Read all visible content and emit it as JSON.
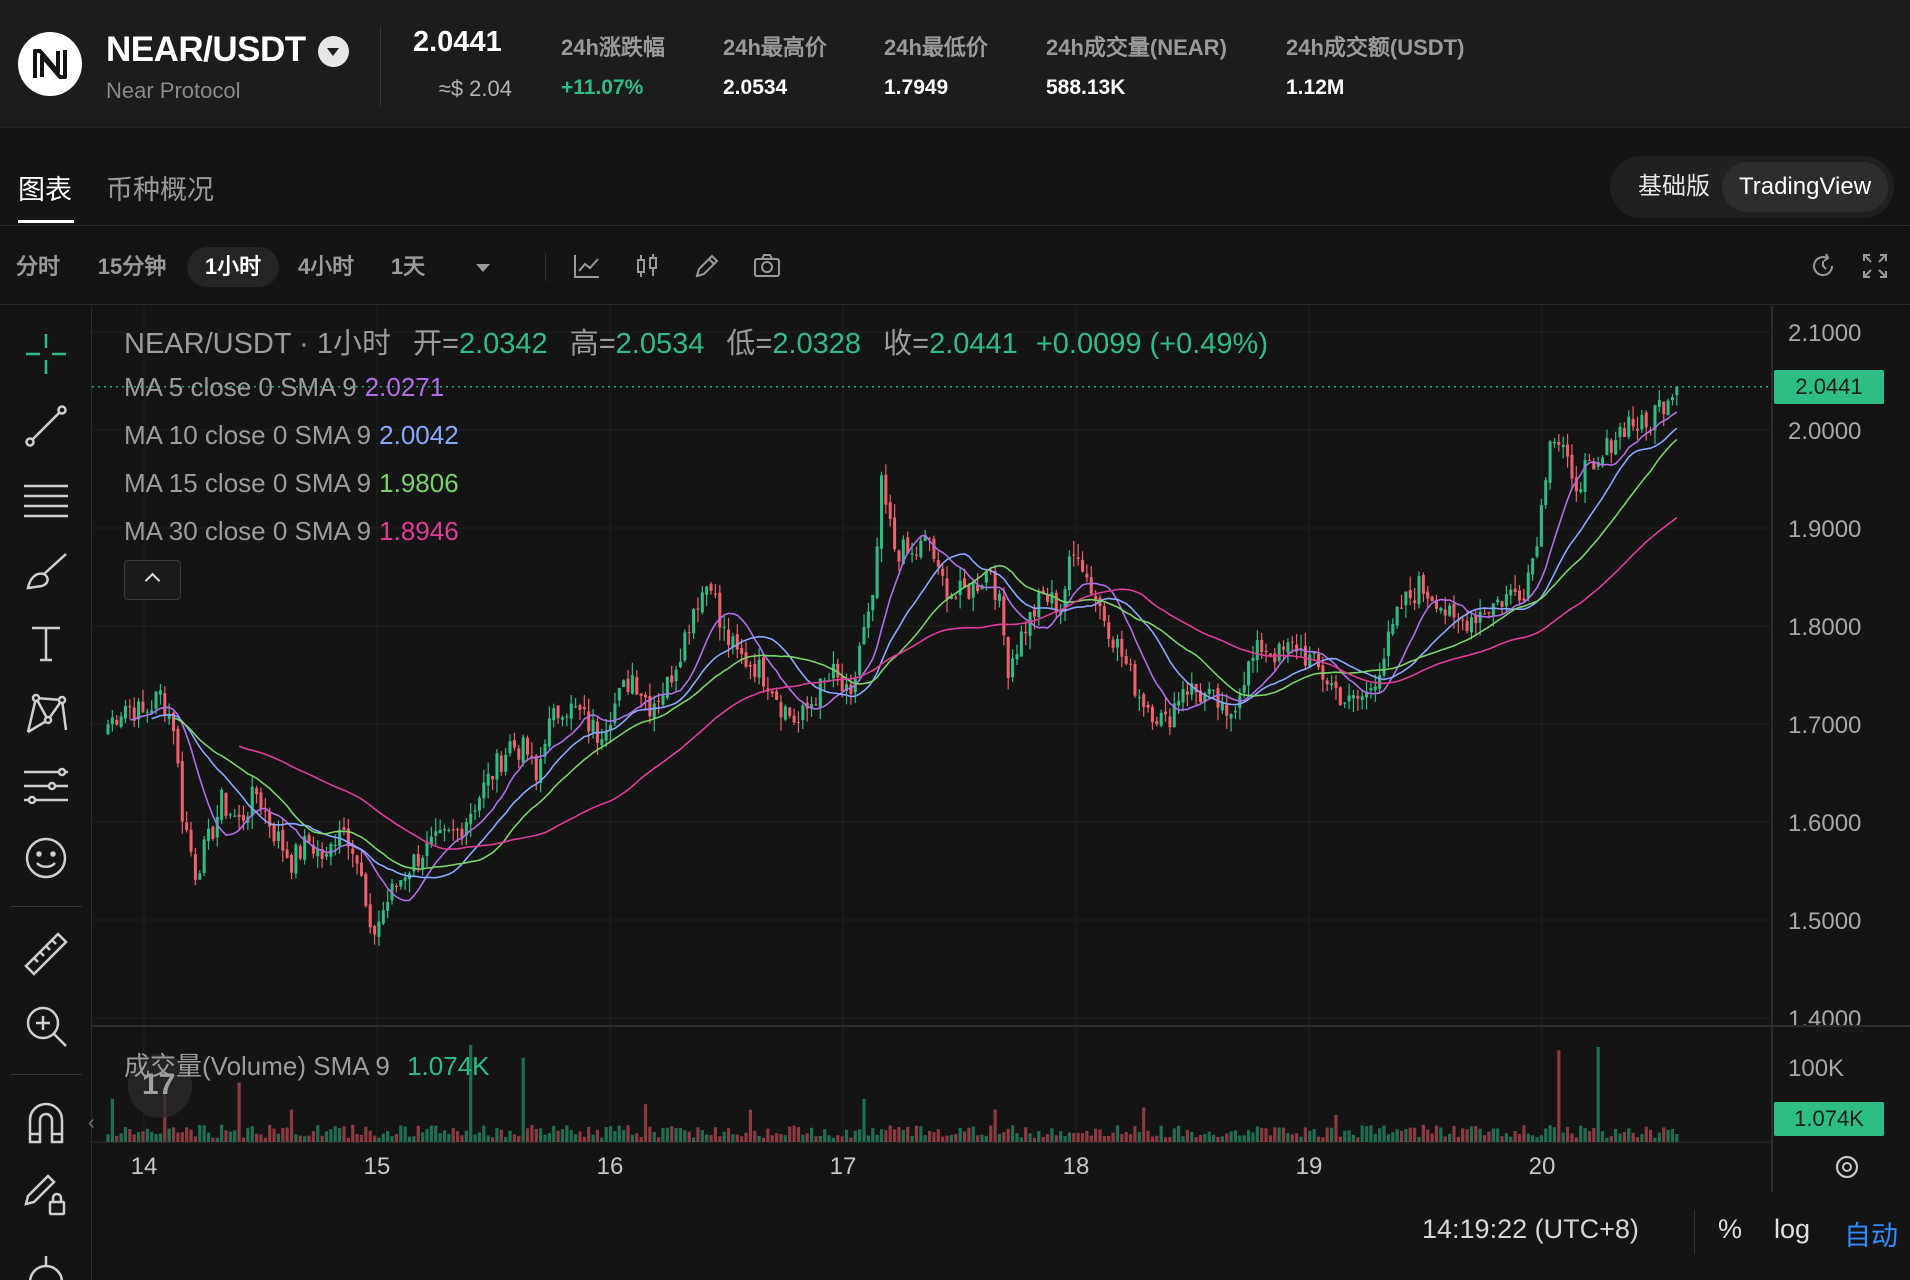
{
  "header": {
    "pair": "NEAR/USDT",
    "name": "Near Protocol",
    "price": "2.0441",
    "price_usd": "≈$ 2.04",
    "stats": [
      {
        "label": "24h涨跌幅",
        "value": "+11.07%"
      },
      {
        "label": "24h最高价",
        "value": "2.0534"
      },
      {
        "label": "24h最低价",
        "value": "1.7949"
      },
      {
        "label": "24h成交量(NEAR)",
        "value": "588.13K"
      },
      {
        "label": "24h成交额(USDT)",
        "value": "1.12M"
      }
    ]
  },
  "tabs": {
    "items": [
      "图表",
      "币种概况"
    ],
    "versions": [
      "基础版",
      "TradingView"
    ]
  },
  "toolbar": {
    "timeframes": [
      "分时",
      "15分钟",
      "1小时",
      "4小时",
      "1天"
    ],
    "active": "1小时"
  },
  "legend": {
    "title": "NEAR/USDT · 1小时",
    "open_label": "开=",
    "open": "2.0342",
    "high_label": "高=",
    "high": "2.0534",
    "low_label": "低=",
    "low": "2.0328",
    "close_label": "收=",
    "close": "2.0441",
    "change": "+0.0099 (+0.49%)",
    "ma": [
      {
        "label": "MA 5 close 0 SMA 9",
        "value": "2.0271",
        "color": "#b06ee8"
      },
      {
        "label": "MA 10 close 0 SMA 9",
        "value": "2.0042",
        "color": "#8aa8ff"
      },
      {
        "label": "MA 15 close 0 SMA 9",
        "value": "1.9806",
        "color": "#79d36a"
      },
      {
        "label": "MA 30 close 0 SMA 9",
        "value": "1.8946",
        "color": "#e03b96"
      }
    ],
    "volume_label": "成交量(Volume) SMA 9",
    "volume_value": "1.074K",
    "tv_badge": "17"
  },
  "axis": {
    "price_tag": "2.0441",
    "volume_tag": "1.074K",
    "volume_tick": "100K"
  },
  "bottom": {
    "clock": "14:19:22 (UTC+8)",
    "opts": [
      "%",
      "log",
      "自动"
    ]
  },
  "chart_data": {
    "type": "candlestick",
    "interval": "1h",
    "ylim": [
      1.4,
      2.1
    ],
    "y_ticks": [
      "2.1000",
      "2.0000",
      "1.9000",
      "1.8000",
      "1.7000",
      "1.6000",
      "1.5000",
      "1.4000"
    ],
    "x_ticks": [
      "14",
      "15",
      "16",
      "17",
      "18",
      "19",
      "20"
    ],
    "last_close": 2.0441,
    "up_color": "#2ebd85",
    "down_color": "#f0616d",
    "close_path": [
      [
        0,
        1.7
      ],
      [
        4,
        1.72
      ],
      [
        8,
        1.71
      ],
      [
        12,
        1.73
      ],
      [
        15,
        1.7
      ],
      [
        17,
        1.61
      ],
      [
        20,
        1.55
      ],
      [
        23,
        1.58
      ],
      [
        26,
        1.62
      ],
      [
        30,
        1.6
      ],
      [
        34,
        1.63
      ],
      [
        38,
        1.59
      ],
      [
        42,
        1.56
      ],
      [
        46,
        1.58
      ],
      [
        50,
        1.56
      ],
      [
        53,
        1.6
      ],
      [
        56,
        1.58
      ],
      [
        58,
        1.54
      ],
      [
        60,
        1.48
      ],
      [
        64,
        1.52
      ],
      [
        68,
        1.55
      ],
      [
        72,
        1.57
      ],
      [
        76,
        1.58
      ],
      [
        80,
        1.59
      ],
      [
        84,
        1.62
      ],
      [
        88,
        1.65
      ],
      [
        92,
        1.68
      ],
      [
        96,
        1.67
      ],
      [
        98,
        1.64
      ],
      [
        100,
        1.69
      ],
      [
        104,
        1.72
      ],
      [
        108,
        1.71
      ],
      [
        112,
        1.69
      ],
      [
        116,
        1.72
      ],
      [
        120,
        1.75
      ],
      [
        124,
        1.72
      ],
      [
        128,
        1.74
      ],
      [
        132,
        1.79
      ],
      [
        134,
        1.82
      ],
      [
        138,
        1.85
      ],
      [
        140,
        1.8
      ],
      [
        144,
        1.77
      ],
      [
        148,
        1.76
      ],
      [
        152,
        1.74
      ],
      [
        154,
        1.72
      ],
      [
        158,
        1.7
      ],
      [
        162,
        1.73
      ],
      [
        166,
        1.75
      ],
      [
        170,
        1.72
      ],
      [
        172,
        1.78
      ],
      [
        175,
        1.82
      ],
      [
        177,
        1.94
      ],
      [
        180,
        1.88
      ],
      [
        184,
        1.87
      ],
      [
        188,
        1.89
      ],
      [
        190,
        1.85
      ],
      [
        194,
        1.83
      ],
      [
        198,
        1.84
      ],
      [
        202,
        1.86
      ],
      [
        204,
        1.82
      ],
      [
        206,
        1.76
      ],
      [
        210,
        1.8
      ],
      [
        214,
        1.83
      ],
      [
        218,
        1.82
      ],
      [
        220,
        1.86
      ],
      [
        222,
        1.88
      ],
      [
        224,
        1.85
      ],
      [
        228,
        1.81
      ],
      [
        232,
        1.77
      ],
      [
        236,
        1.73
      ],
      [
        240,
        1.71
      ],
      [
        242,
        1.7
      ],
      [
        246,
        1.74
      ],
      [
        250,
        1.73
      ],
      [
        254,
        1.72
      ],
      [
        256,
        1.7
      ],
      [
        260,
        1.75
      ],
      [
        264,
        1.78
      ],
      [
        268,
        1.77
      ],
      [
        272,
        1.78
      ],
      [
        276,
        1.76
      ],
      [
        280,
        1.74
      ],
      [
        284,
        1.72
      ],
      [
        288,
        1.73
      ],
      [
        292,
        1.77
      ],
      [
        296,
        1.82
      ],
      [
        300,
        1.84
      ],
      [
        304,
        1.83
      ],
      [
        308,
        1.8
      ],
      [
        312,
        1.81
      ],
      [
        316,
        1.82
      ],
      [
        320,
        1.83
      ],
      [
        324,
        1.84
      ],
      [
        326,
        1.87
      ],
      [
        328,
        1.92
      ],
      [
        330,
        2.0
      ],
      [
        333,
        1.98
      ],
      [
        335,
        1.94
      ],
      [
        338,
        1.96
      ],
      [
        340,
        1.95
      ],
      [
        344,
        1.99
      ],
      [
        348,
        2.01
      ],
      [
        352,
        2.0
      ],
      [
        354,
        2.02
      ],
      [
        356,
        2.03
      ],
      [
        358,
        2.0441
      ]
    ],
    "volume": {
      "label": "成交量(Volume) SMA 9",
      "sma": "1.074K",
      "tick": "100K",
      "spikes": [
        [
          1,
          0.4
        ],
        [
          13,
          0.45
        ],
        [
          30,
          0.55
        ],
        [
          42,
          0.3
        ],
        [
          83,
          0.9
        ],
        [
          95,
          0.78
        ],
        [
          123,
          0.35
        ],
        [
          147,
          0.3
        ],
        [
          173,
          0.4
        ],
        [
          203,
          0.3
        ],
        [
          237,
          0.32
        ],
        [
          281,
          0.25
        ],
        [
          332,
          0.85
        ],
        [
          341,
          0.88
        ]
      ]
    }
  }
}
